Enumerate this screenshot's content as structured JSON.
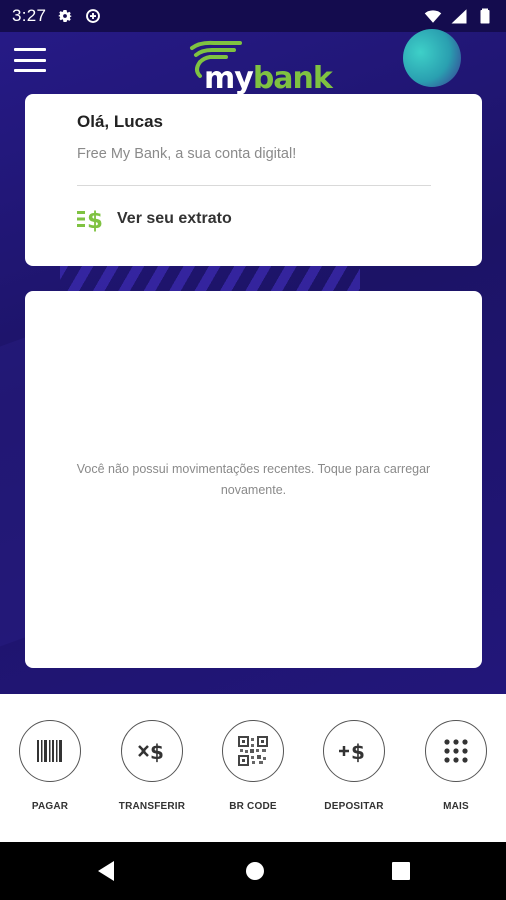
{
  "status_bar": {
    "time": "3:27",
    "icons": [
      "gear-icon",
      "data-saver-icon",
      "wifi-icon",
      "signal-icon",
      "battery-icon"
    ]
  },
  "header": {
    "menu_icon": "hamburger-menu-icon",
    "logo": {
      "prefix": "my",
      "suffix": "bank",
      "brand_color": "#7fc241"
    }
  },
  "greeting_card": {
    "title": "Olá, Lucas",
    "subtitle": "Free My Bank, a sua conta digital!",
    "extrato_label": "Ver seu extrato",
    "extrato_icon": "statement-dollar-icon"
  },
  "movements_card": {
    "empty_message": "Você não possui movimentações recentes. Toque para carregar novamente."
  },
  "actions": [
    {
      "label": "PAGAR",
      "icon": "barcode-icon"
    },
    {
      "label": "TRANSFERIR",
      "icon": "transfer-dollar-icon"
    },
    {
      "label": "BR CODE",
      "icon": "qr-code-icon"
    },
    {
      "label": "DEPOSITAR",
      "icon": "deposit-dollar-icon"
    },
    {
      "label": "MAIS",
      "icon": "grid-dots-icon"
    }
  ],
  "nav_bar": {
    "buttons": [
      "back-icon",
      "home-icon",
      "recents-icon"
    ]
  },
  "colors": {
    "background": "#1f1470",
    "accent_green": "#7fc241",
    "card": "#ffffff"
  }
}
